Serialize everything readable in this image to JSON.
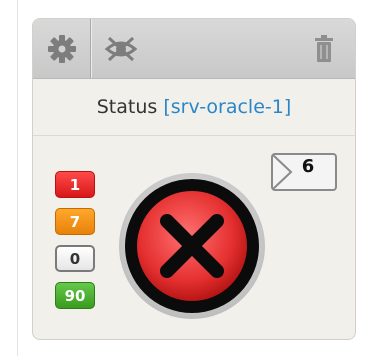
{
  "toolbar": {
    "settings_icon": "gear-icon",
    "hide_icon": "eye-slash-icon",
    "delete_icon": "trash-icon"
  },
  "widget": {
    "status_label": "Status",
    "bracket_open": "[",
    "host": "srv-oracle-1",
    "bracket_close": "]",
    "status_icon": "error-x-icon",
    "status_color": "#e03030"
  },
  "counts": {
    "critical": "1",
    "warning": "7",
    "unknown": "0",
    "ok": "90"
  },
  "messages": {
    "icon": "envelope-icon",
    "count": "6"
  }
}
